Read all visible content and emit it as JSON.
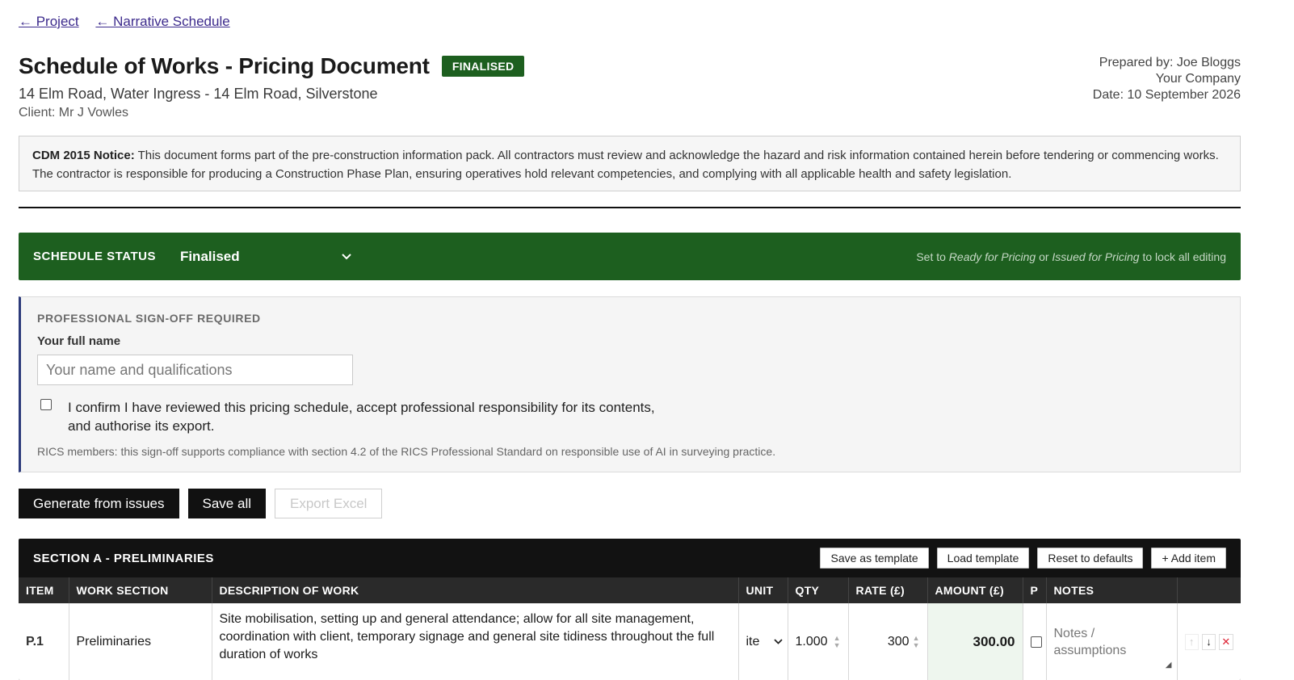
{
  "nav": {
    "back_project": "← Project",
    "back_narrative": "← Narrative Schedule"
  },
  "header": {
    "title": "Schedule of Works - Pricing Document",
    "badge": "FINALISED",
    "subtitle": "14 Elm Road, Water Ingress - 14 Elm Road, Silverstone",
    "client": "Client: Mr J Vowles",
    "prepared_by": "Prepared by: Joe Bloggs",
    "company": "Your Company",
    "date": "Date: 10 September 2026"
  },
  "cdm": {
    "label": "CDM 2015 Notice:",
    "text": " This document forms part of the pre-construction information pack. All contractors must review and acknowledge the hazard and risk information contained herein before tendering or commencing works. The contractor is responsible for producing a Construction Phase Plan, ensuring operatives hold relevant competencies, and complying with all applicable health and safety legislation."
  },
  "status": {
    "label": "SCHEDULE STATUS",
    "value": "Finalised",
    "hint_prefix": "Set to ",
    "hint_a": "Ready for Pricing",
    "hint_mid": " or ",
    "hint_b": "Issued for Pricing",
    "hint_suffix": " to lock all editing"
  },
  "signoff": {
    "title": "PROFESSIONAL SIGN-OFF REQUIRED",
    "name_label": "Your full name",
    "name_placeholder": "Your name and qualifications",
    "confirm_text": "I confirm I have reviewed this pricing schedule, accept professional responsibility for its contents, and authorise its export.",
    "rics_note": "RICS members: this sign-off supports compliance with section 4.2 of the RICS Professional Standard on responsible use of AI in surveying practice."
  },
  "actions": {
    "generate": "Generate from issues",
    "save_all": "Save all",
    "export": "Export Excel"
  },
  "section": {
    "title": "SECTION A - PRELIMINARIES",
    "buttons": {
      "save_template": "Save as template",
      "load_template": "Load template",
      "reset": "Reset to defaults",
      "add_item": "+ Add item"
    },
    "columns": {
      "item": "ITEM",
      "work_section": "WORK SECTION",
      "description": "DESCRIPTION OF WORK",
      "unit": "UNIT",
      "qty": "QTY",
      "rate": "RATE (£)",
      "amount": "AMOUNT (£)",
      "p": "P",
      "notes": "NOTES"
    },
    "rows": [
      {
        "item": "P.1",
        "work_section": "Preliminaries",
        "description": "Site mobilisation, setting up and general attendance; allow for all site management, coordination with client, temporary signage and general site tidiness throughout the full duration of works",
        "unit": "ite",
        "qty": "1.000",
        "rate": "300",
        "amount": "300.00",
        "notes_placeholder": "Notes / assumptions"
      }
    ]
  }
}
